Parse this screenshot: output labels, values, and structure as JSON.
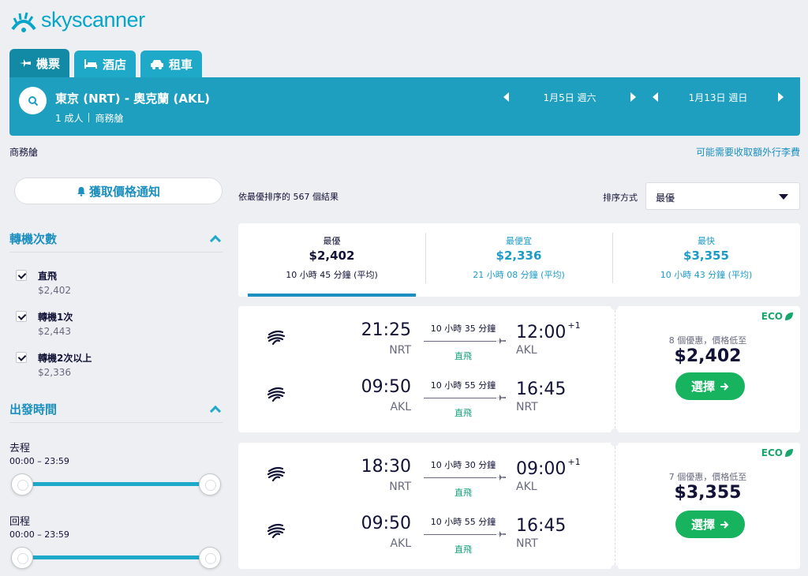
{
  "brand": {
    "name": "skyscanner"
  },
  "tabs": [
    {
      "label": "機票",
      "icon": "plane-icon",
      "active": true
    },
    {
      "label": "酒店",
      "icon": "bed-icon",
      "active": false
    },
    {
      "label": "租車",
      "icon": "car-icon",
      "active": false
    }
  ],
  "search": {
    "route": "東京 (NRT) - 奧克蘭 (AKL)",
    "passengers": "1 成人",
    "cabin": "商務艙",
    "depart_date": "1月5日 週六",
    "return_date": "1月13日 週日"
  },
  "cabin_note": "商務艙",
  "baggage_link": "可能需要收取額外行李費",
  "price_alert_label": "獲取價格通知",
  "filters": {
    "stops_title": "轉機次數",
    "stops": [
      {
        "label": "直飛",
        "price": "$2,402",
        "checked": true
      },
      {
        "label": "轉機1次",
        "price": "$2,443",
        "checked": true
      },
      {
        "label": "轉機2次以上",
        "price": "$2,336",
        "checked": true
      }
    ],
    "times_title": "出發時間",
    "outbound_label": "去程",
    "outbound_range": "00:00 – 23:59",
    "return_label": "回程",
    "return_range": "00:00 – 23:59"
  },
  "results": {
    "count_text": "依最優排序的 567 個結果",
    "sort_label": "排序方式",
    "sort_value": "最優"
  },
  "summary": [
    {
      "label": "最優",
      "price": "$2,402",
      "duration": "10 小時 45 分鐘 (平均)",
      "selected": true
    },
    {
      "label": "最便宜",
      "price": "$2,336",
      "duration": "21 小時 08 分鐘 (平均)",
      "selected": false
    },
    {
      "label": "最快",
      "price": "$3,355",
      "duration": "10 小時 43 分鐘 (平均)",
      "selected": false
    }
  ],
  "cards": [
    {
      "eco": "ECO",
      "deals": "8 個優惠，價格低至",
      "price": "$2,402",
      "select_label": "選擇",
      "legs": [
        {
          "dep_time": "21:25",
          "dep_code": "NRT",
          "duration": "10 小時 35 分鐘",
          "stops": "直飛",
          "arr_time": "12:00",
          "day_offset": "+1",
          "arr_code": "AKL"
        },
        {
          "dep_time": "09:50",
          "dep_code": "AKL",
          "duration": "10 小時 55 分鐘",
          "stops": "直飛",
          "arr_time": "16:45",
          "day_offset": "",
          "arr_code": "NRT"
        }
      ]
    },
    {
      "eco": "ECO",
      "deals": "7 個優惠，價格低至",
      "price": "$3,355",
      "select_label": "選擇",
      "legs": [
        {
          "dep_time": "18:30",
          "dep_code": "NRT",
          "duration": "10 小時 30 分鐘",
          "stops": "直飛",
          "arr_time": "09:00",
          "day_offset": "+1",
          "arr_code": "AKL"
        },
        {
          "dep_time": "09:50",
          "dep_code": "AKL",
          "duration": "10 小時 55 分鐘",
          "stops": "直飛",
          "arr_time": "16:45",
          "day_offset": "",
          "arr_code": "NRT"
        }
      ]
    }
  ],
  "colors": {
    "brand": "#07a6c9",
    "header": "#1f9fbf",
    "accent_link": "#1b8fbf",
    "select_button": "#18b35f",
    "eco": "#17a76c"
  }
}
